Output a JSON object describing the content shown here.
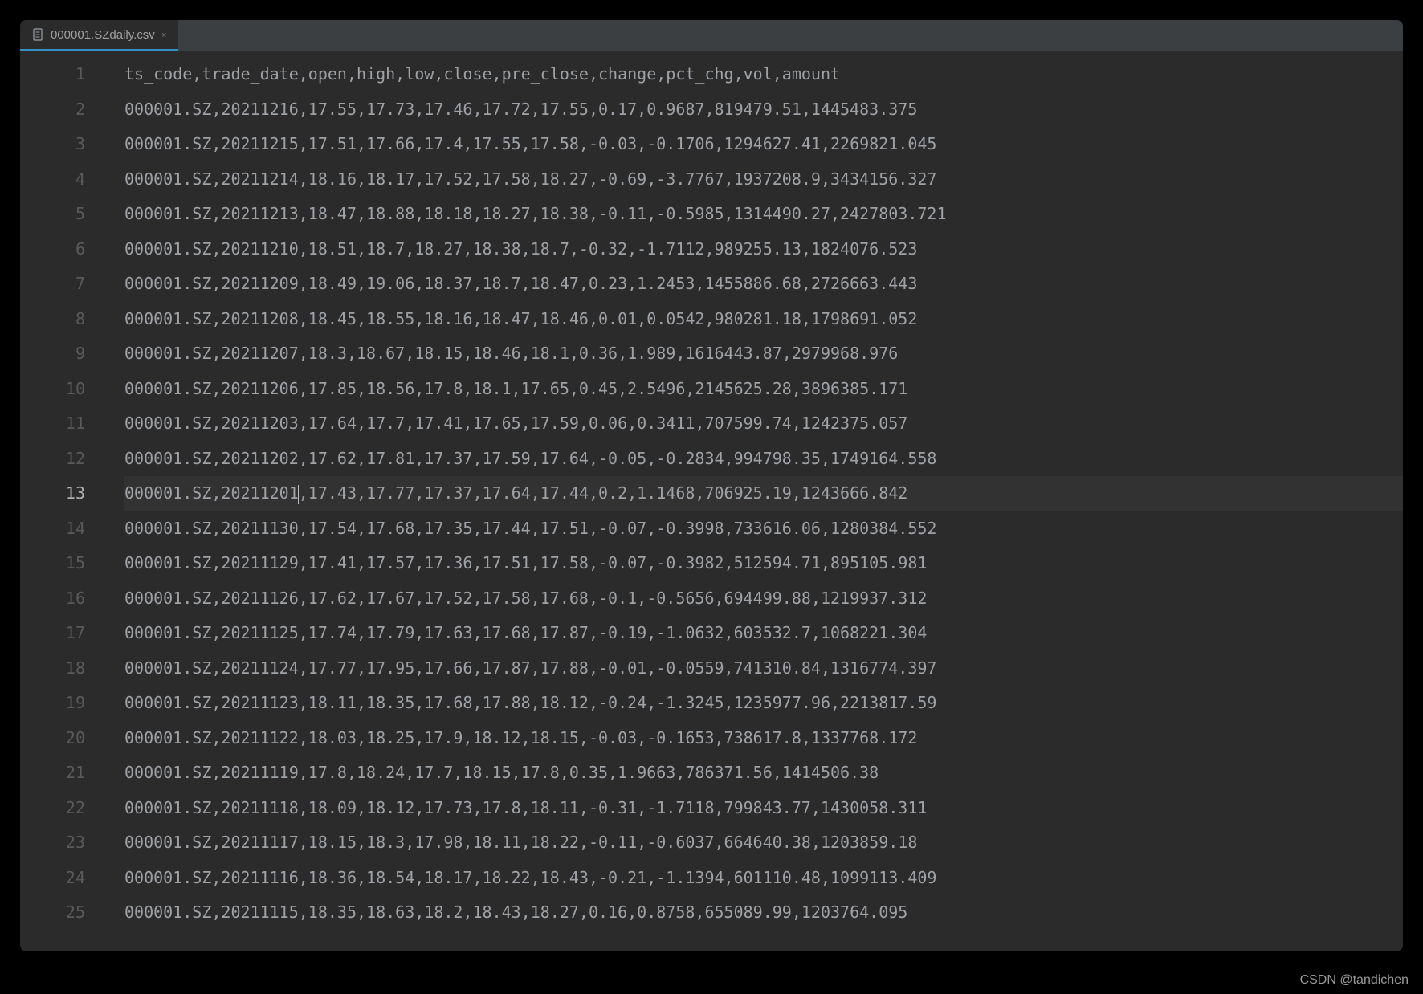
{
  "tab": {
    "title": "000001.SZdaily.csv",
    "close_label": "✕"
  },
  "active_line": 13,
  "cursor_col_text_before": "000001.SZ,20211201",
  "cursor_col_text_after": ",17.43,17.77,17.37,17.64,17.44,0.2,1.1468,706925.19,1243666.842",
  "lines": [
    "ts_code,trade_date,open,high,low,close,pre_close,change,pct_chg,vol,amount",
    "000001.SZ,20211216,17.55,17.73,17.46,17.72,17.55,0.17,0.9687,819479.51,1445483.375",
    "000001.SZ,20211215,17.51,17.66,17.4,17.55,17.58,-0.03,-0.1706,1294627.41,2269821.045",
    "000001.SZ,20211214,18.16,18.17,17.52,17.58,18.27,-0.69,-3.7767,1937208.9,3434156.327",
    "000001.SZ,20211213,18.47,18.88,18.18,18.27,18.38,-0.11,-0.5985,1314490.27,2427803.721",
    "000001.SZ,20211210,18.51,18.7,18.27,18.38,18.7,-0.32,-1.7112,989255.13,1824076.523",
    "000001.SZ,20211209,18.49,19.06,18.37,18.7,18.47,0.23,1.2453,1455886.68,2726663.443",
    "000001.SZ,20211208,18.45,18.55,18.16,18.47,18.46,0.01,0.0542,980281.18,1798691.052",
    "000001.SZ,20211207,18.3,18.67,18.15,18.46,18.1,0.36,1.989,1616443.87,2979968.976",
    "000001.SZ,20211206,17.85,18.56,17.8,18.1,17.65,0.45,2.5496,2145625.28,3896385.171",
    "000001.SZ,20211203,17.64,17.7,17.41,17.65,17.59,0.06,0.3411,707599.74,1242375.057",
    "000001.SZ,20211202,17.62,17.81,17.37,17.59,17.64,-0.05,-0.2834,994798.35,1749164.558",
    "000001.SZ,20211201,17.43,17.77,17.37,17.64,17.44,0.2,1.1468,706925.19,1243666.842",
    "000001.SZ,20211130,17.54,17.68,17.35,17.44,17.51,-0.07,-0.3998,733616.06,1280384.552",
    "000001.SZ,20211129,17.41,17.57,17.36,17.51,17.58,-0.07,-0.3982,512594.71,895105.981",
    "000001.SZ,20211126,17.62,17.67,17.52,17.58,17.68,-0.1,-0.5656,694499.88,1219937.312",
    "000001.SZ,20211125,17.74,17.79,17.63,17.68,17.87,-0.19,-1.0632,603532.7,1068221.304",
    "000001.SZ,20211124,17.77,17.95,17.66,17.87,17.88,-0.01,-0.0559,741310.84,1316774.397",
    "000001.SZ,20211123,18.11,18.35,17.68,17.88,18.12,-0.24,-1.3245,1235977.96,2213817.59",
    "000001.SZ,20211122,18.03,18.25,17.9,18.12,18.15,-0.03,-0.1653,738617.8,1337768.172",
    "000001.SZ,20211119,17.8,18.24,17.7,18.15,17.8,0.35,1.9663,786371.56,1414506.38",
    "000001.SZ,20211118,18.09,18.12,17.73,17.8,18.11,-0.31,-1.7118,799843.77,1430058.311",
    "000001.SZ,20211117,18.15,18.3,17.98,18.11,18.22,-0.11,-0.6037,664640.38,1203859.18",
    "000001.SZ,20211116,18.36,18.54,18.17,18.22,18.43,-0.21,-1.1394,601110.48,1099113.409",
    "000001.SZ,20211115,18.35,18.63,18.2,18.43,18.27,0.16,0.8758,655089.99,1203764.095"
  ],
  "watermark": "CSDN @tandichen"
}
